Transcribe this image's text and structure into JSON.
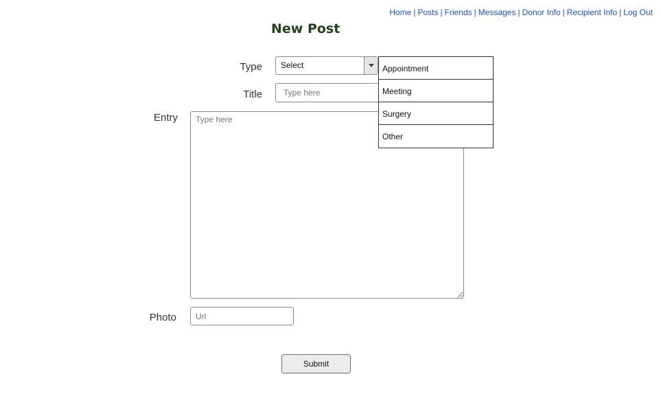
{
  "nav": {
    "items": [
      "Home",
      "Posts",
      "Friends",
      "Messages",
      "Donor Info",
      "Recipient Info",
      "Log Out"
    ],
    "separator": "|"
  },
  "page": {
    "title": "New Post"
  },
  "form": {
    "type_label": "Type",
    "type_value": "Select",
    "type_options": [
      "Appointment",
      "Meeting",
      "Surgery",
      "Other"
    ],
    "title_label": "Title",
    "title_placeholder": "Type here",
    "entry_label": "Entry",
    "entry_placeholder": "Type here",
    "photo_label": "Photo",
    "photo_placeholder": "Url",
    "submit_label": "Submit"
  }
}
